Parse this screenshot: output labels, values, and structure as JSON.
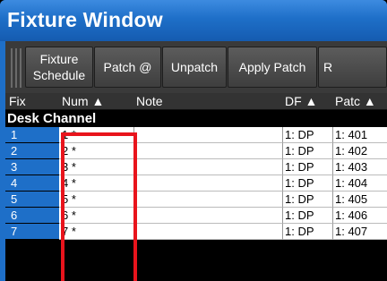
{
  "window": {
    "title": "Fixture Window"
  },
  "toolbar": {
    "buttons": [
      {
        "label": "Fixture\nSchedule"
      },
      {
        "label": "Patch @"
      },
      {
        "label": "Unpatch"
      },
      {
        "label": "Apply Patch"
      },
      {
        "label": "R"
      }
    ]
  },
  "grid": {
    "columns": [
      {
        "label": "Fix"
      },
      {
        "label": "Num ▲"
      },
      {
        "label": "Note"
      },
      {
        "label": "DF ▲"
      },
      {
        "label": "Patc ▲"
      }
    ],
    "group_title": "Desk Channel",
    "rows": [
      {
        "fix": "1",
        "num": "1 *",
        "dp": "1: DP",
        "patch": "1: 401"
      },
      {
        "fix": "2",
        "num": "2 *",
        "dp": "1: DP",
        "patch": "1: 402"
      },
      {
        "fix": "3",
        "num": "3 *",
        "dp": "1: DP",
        "patch": "1: 403"
      },
      {
        "fix": "4",
        "num": "4 *",
        "dp": "1: DP",
        "patch": "1: 404"
      },
      {
        "fix": "5",
        "num": "5 *",
        "dp": "1: DP",
        "patch": "1: 405"
      },
      {
        "fix": "6",
        "num": "6 *",
        "dp": "1: DP",
        "patch": "1: 406"
      },
      {
        "fix": "7",
        "num": "7 *",
        "dp": "1: DP",
        "patch": "1: 407"
      }
    ]
  },
  "colors": {
    "title_blue": "#1e6fc8",
    "highlight": "#e8141c"
  }
}
